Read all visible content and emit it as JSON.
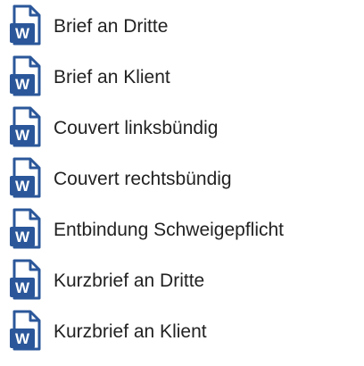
{
  "icon": "word-document-icon",
  "icon_colors": {
    "stroke": "#2b579a",
    "badge": "#2b579a",
    "badge_text": "#ffffff"
  },
  "icon_letter": "W",
  "files": [
    {
      "label": "Brief an Dritte"
    },
    {
      "label": "Brief an Klient"
    },
    {
      "label": "Couvert linksbündig"
    },
    {
      "label": "Couvert rechtsbündig"
    },
    {
      "label": "Entbindung Schweigepflicht"
    },
    {
      "label": "Kurzbrief an Dritte"
    },
    {
      "label": "Kurzbrief an Klient"
    }
  ]
}
